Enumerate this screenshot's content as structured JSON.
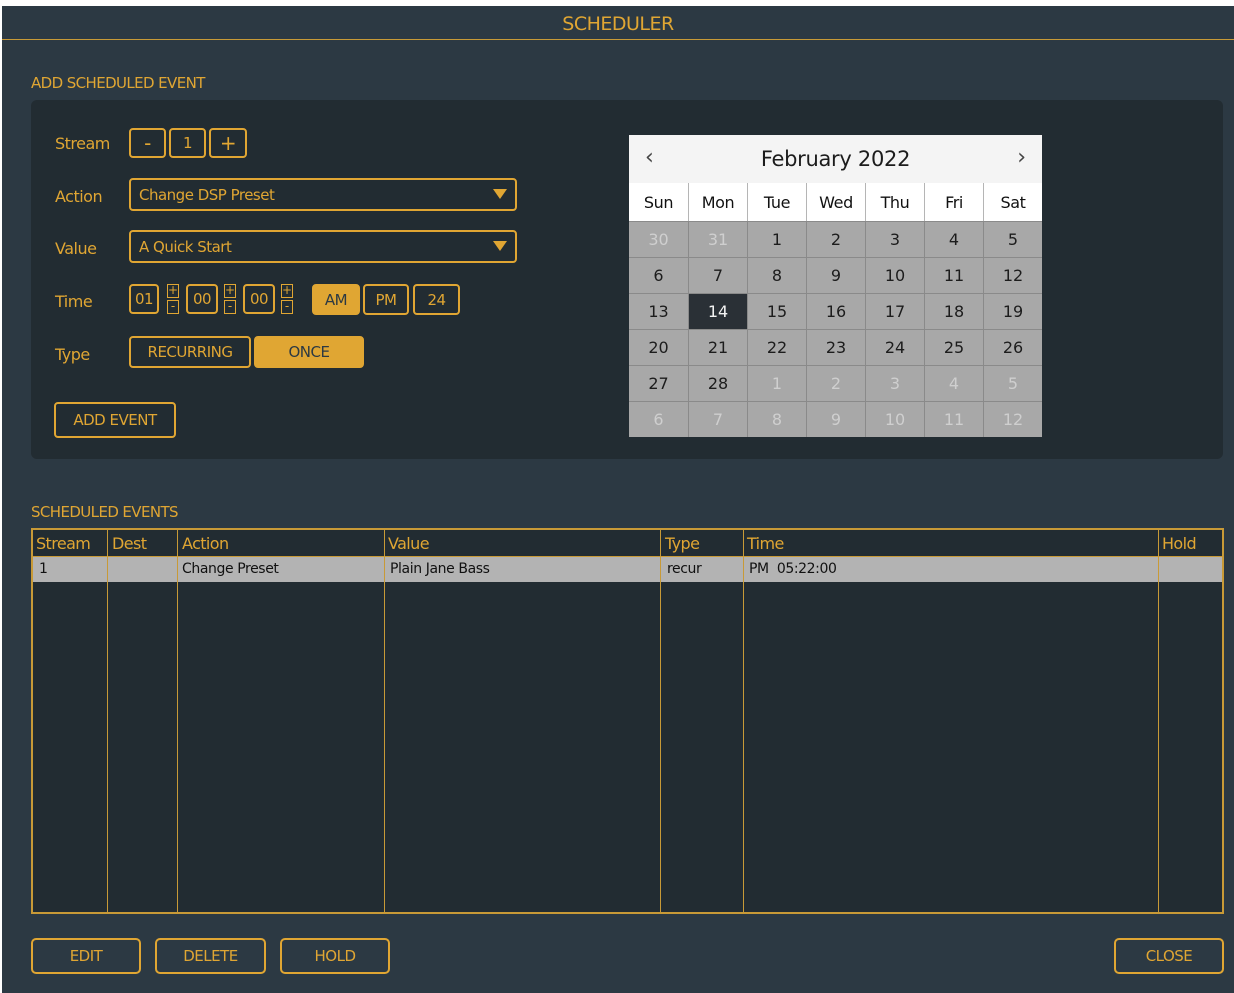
{
  "window": {
    "title": "SCHEDULER"
  },
  "add_section": {
    "label": "ADD SCHEDULED EVENT",
    "stream": {
      "label": "Stream",
      "minus": "-",
      "value": "1",
      "plus": "+"
    },
    "action": {
      "label": "Action",
      "value": "Change DSP Preset"
    },
    "value_field": {
      "label": "Value",
      "value": "A Quick Start"
    },
    "time": {
      "label": "Time",
      "hour": "01",
      "minute": "00",
      "second": "00",
      "modes": [
        "AM",
        "PM",
        "24"
      ],
      "active_mode": "AM"
    },
    "type": {
      "label": "Type",
      "options": [
        "RECURRING",
        "ONCE"
      ],
      "active": "ONCE"
    },
    "add_button": "ADD EVENT"
  },
  "calendar": {
    "month_label": "February 2022",
    "prev_icon": "‹",
    "next_icon": "›",
    "weekdays": [
      "Sun",
      "Mon",
      "Tue",
      "Wed",
      "Thu",
      "Fri",
      "Sat"
    ],
    "weeks": [
      [
        [
          "30",
          1
        ],
        [
          "31",
          1
        ],
        [
          "1",
          0
        ],
        [
          "2",
          0
        ],
        [
          "3",
          0
        ],
        [
          "4",
          0
        ],
        [
          "5",
          0
        ]
      ],
      [
        [
          "6",
          0
        ],
        [
          "7",
          0
        ],
        [
          "8",
          0
        ],
        [
          "9",
          0
        ],
        [
          "10",
          0
        ],
        [
          "11",
          0
        ],
        [
          "12",
          0
        ]
      ],
      [
        [
          "13",
          0
        ],
        [
          "14",
          2
        ],
        [
          "15",
          0
        ],
        [
          "16",
          0
        ],
        [
          "17",
          0
        ],
        [
          "18",
          0
        ],
        [
          "19",
          0
        ]
      ],
      [
        [
          "20",
          0
        ],
        [
          "21",
          0
        ],
        [
          "22",
          0
        ],
        [
          "23",
          0
        ],
        [
          "24",
          0
        ],
        [
          "25",
          0
        ],
        [
          "26",
          0
        ]
      ],
      [
        [
          "27",
          0
        ],
        [
          "28",
          0
        ],
        [
          "1",
          1
        ],
        [
          "2",
          1
        ],
        [
          "3",
          1
        ],
        [
          "4",
          1
        ],
        [
          "5",
          1
        ]
      ],
      [
        [
          "6",
          1
        ],
        [
          "7",
          1
        ],
        [
          "8",
          1
        ],
        [
          "9",
          1
        ],
        [
          "10",
          1
        ],
        [
          "11",
          1
        ],
        [
          "12",
          1
        ]
      ]
    ]
  },
  "events_section": {
    "label": "SCHEDULED EVENTS",
    "columns": [
      "Stream",
      "Dest",
      "Action",
      "Value",
      "Type",
      "Time",
      "Hold"
    ],
    "rows": [
      [
        "1",
        "",
        "Change Preset",
        "Plain Jane Bass",
        "recur",
        "PM  05:22:00",
        ""
      ]
    ]
  },
  "footer": {
    "edit": "EDIT",
    "delete": "DELETE",
    "hold": "HOLD",
    "close": "CLOSE"
  },
  "colors": {
    "background": "#2c3943",
    "panel": "#222c32",
    "accent": "#e0a633",
    "row_selected": "#b3b3b3"
  }
}
